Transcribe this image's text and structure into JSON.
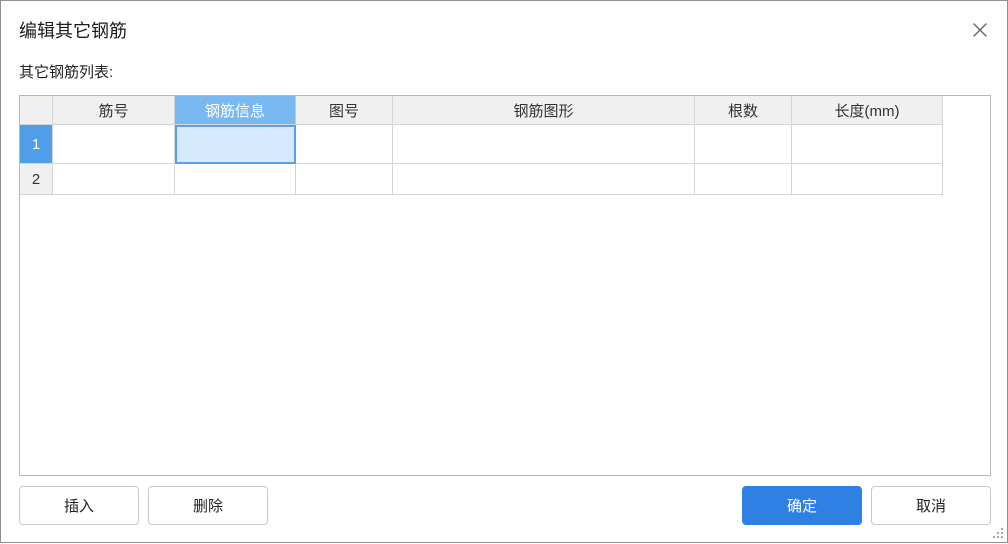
{
  "window": {
    "title": "编辑其它钢筋"
  },
  "list_label": "其它钢筋列表:",
  "table": {
    "columns": [
      "筋号",
      "钢筋信息",
      "图号",
      "钢筋图形",
      "根数",
      "长度(mm)"
    ],
    "rows": [
      {
        "index": "1",
        "cells": [
          "",
          "",
          "",
          "",
          "",
          ""
        ]
      },
      {
        "index": "2",
        "cells": [
          "",
          "",
          "",
          "",
          "",
          ""
        ]
      }
    ]
  },
  "buttons": {
    "insert": "插入",
    "delete": "删除",
    "ok": "确定",
    "cancel": "取消"
  },
  "icons": {
    "close": "close-icon",
    "resize": "resize-grip-icon"
  },
  "colors": {
    "primary": "#2f80e3",
    "selection_header": "#7ab8f2",
    "selection_row_header": "#4f9ee9",
    "selection_cell_fill": "#d7e9fd",
    "selection_cell_border": "#5d9fe5"
  }
}
